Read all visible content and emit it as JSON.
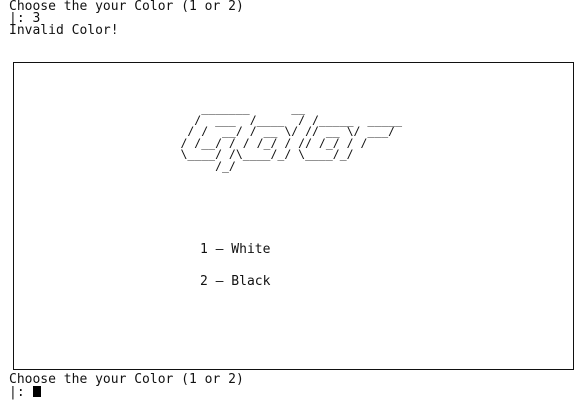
{
  "terminal": {
    "prompt_top": "Choose the your Color (1 or 2)",
    "input_line": "|: 3",
    "error_message": "Invalid Color!",
    "prompt_bottom": "Choose the your Color (1 or 2)",
    "input_prefix": "|: "
  },
  "menu": {
    "logo_text": "Color",
    "logo_art": "          _______      __\n         /  ___  /____  / /_____  _____\n        / /  __/ / __ \\/ // __ \\/ ___/\n       / /__/ / / /_/ / // /_/ / /\n       \\____/ /\\____/_/ \\____/_/\n            /_/",
    "options": [
      "1 – White",
      "2 – Black"
    ]
  }
}
